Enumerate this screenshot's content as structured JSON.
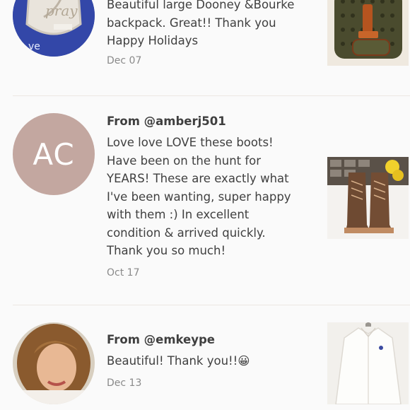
{
  "reviews": [
    {
      "from": "",
      "text": "Beautiful large Dooney &Bourke\nbackpack. Great!! Thank you\nHappy Holidays",
      "date": "Dec 07",
      "avatar_initials": "",
      "avatar_type": "photo-badge",
      "product": "backpack"
    },
    {
      "from": "From @amberj501",
      "text": "Love love LOVE these boots!\nHave been on the hunt for\nYEARS! These are exactly what\nI've been wanting, super happy\nwith them :) In excellent\ncondition & arrived quickly.\nThank you so much!",
      "date": "Oct 17",
      "avatar_initials": "AC",
      "avatar_type": "initials",
      "product": "boots"
    },
    {
      "from": "From @emkeype",
      "text": "Beautiful! Thank you!!😀",
      "date": "Dec 13",
      "avatar_initials": "",
      "avatar_type": "photo-person",
      "product": "white-shirt"
    }
  ],
  "colors": {
    "background": "#fafafa",
    "divider": "#ece7e3",
    "initials_avatar": "#c3a7a0",
    "date_text": "#8a8a8a"
  }
}
